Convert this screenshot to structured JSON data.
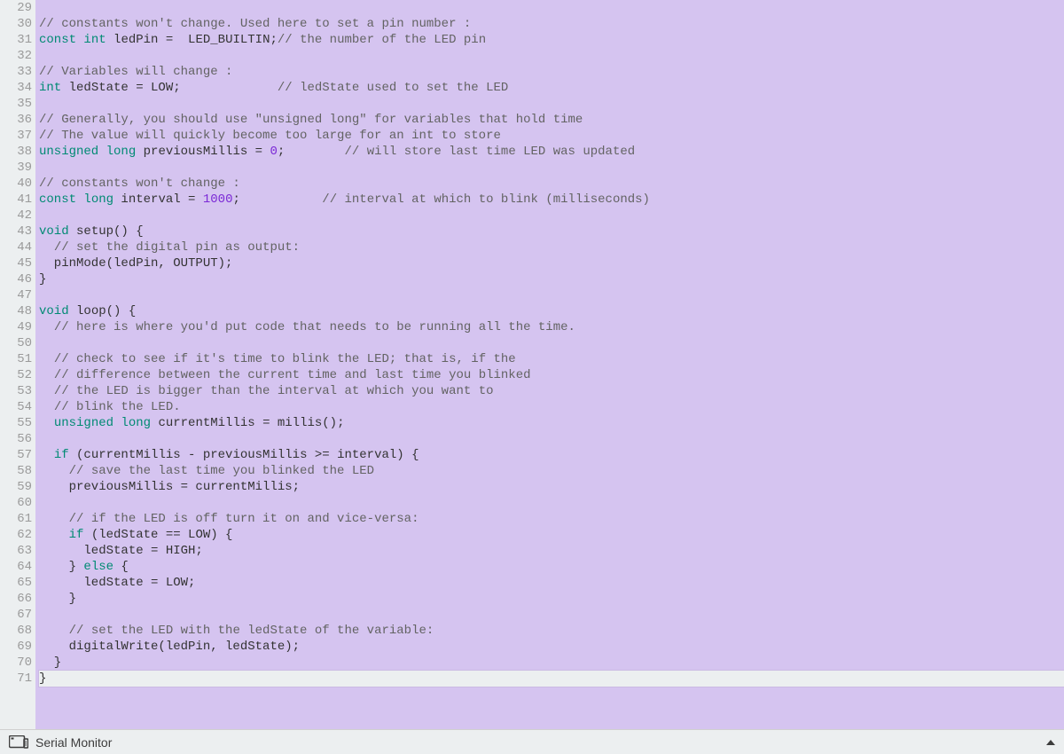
{
  "editor": {
    "first_line_number": 29,
    "cursor_line": 71,
    "lines": [
      [],
      [
        [
          "// constants won't change. Used here to set a pin number :",
          "cmt"
        ]
      ],
      [
        [
          "const",
          "kw"
        ],
        [
          " ",
          "p"
        ],
        [
          "int",
          "kw"
        ],
        [
          " ledPin =  LED_BUILTIN;",
          "p"
        ],
        [
          "// the number of the LED pin",
          "cmt"
        ]
      ],
      [],
      [
        [
          "// Variables will change :",
          "cmt"
        ]
      ],
      [
        [
          "int",
          "kw"
        ],
        [
          " ledState = LOW;             ",
          "p"
        ],
        [
          "// ledState used to set the LED",
          "cmt"
        ]
      ],
      [],
      [
        [
          "// Generally, you should use \"unsigned long\" for variables that hold time",
          "cmt"
        ]
      ],
      [
        [
          "// The value will quickly become too large for an int to store",
          "cmt"
        ]
      ],
      [
        [
          "unsigned",
          "kw"
        ],
        [
          " ",
          "p"
        ],
        [
          "long",
          "kw"
        ],
        [
          " previousMillis = ",
          "p"
        ],
        [
          "0",
          "num"
        ],
        [
          ";        ",
          "p"
        ],
        [
          "// will store last time LED was updated",
          "cmt"
        ]
      ],
      [],
      [
        [
          "// constants won't change :",
          "cmt"
        ]
      ],
      [
        [
          "const",
          "kw"
        ],
        [
          " ",
          "p"
        ],
        [
          "long",
          "kw"
        ],
        [
          " interval = ",
          "p"
        ],
        [
          "1000",
          "num"
        ],
        [
          ";           ",
          "p"
        ],
        [
          "// interval at which to blink (milliseconds)",
          "cmt"
        ]
      ],
      [],
      [
        [
          "void",
          "kw"
        ],
        [
          " setup() {",
          "p"
        ]
      ],
      [
        [
          "  ",
          "p"
        ],
        [
          "// set the digital pin as output:",
          "cmt"
        ]
      ],
      [
        [
          "  pinMode(ledPin, OUTPUT);",
          "p"
        ]
      ],
      [
        [
          "}",
          "p"
        ]
      ],
      [],
      [
        [
          "void",
          "kw"
        ],
        [
          " loop() {",
          "p"
        ]
      ],
      [
        [
          "  ",
          "p"
        ],
        [
          "// here is where you'd put code that needs to be running all the time.",
          "cmt"
        ]
      ],
      [],
      [
        [
          "  ",
          "p"
        ],
        [
          "// check to see if it's time to blink the LED; that is, if the",
          "cmt"
        ]
      ],
      [
        [
          "  ",
          "p"
        ],
        [
          "// difference between the current time and last time you blinked",
          "cmt"
        ]
      ],
      [
        [
          "  ",
          "p"
        ],
        [
          "// the LED is bigger than the interval at which you want to",
          "cmt"
        ]
      ],
      [
        [
          "  ",
          "p"
        ],
        [
          "// blink the LED.",
          "cmt"
        ]
      ],
      [
        [
          "  ",
          "p"
        ],
        [
          "unsigned",
          "kw"
        ],
        [
          " ",
          "p"
        ],
        [
          "long",
          "kw"
        ],
        [
          " currentMillis = millis();",
          "p"
        ]
      ],
      [],
      [
        [
          "  ",
          "p"
        ],
        [
          "if",
          "kw"
        ],
        [
          " (currentMillis - previousMillis >= interval) {",
          "p"
        ]
      ],
      [
        [
          "    ",
          "p"
        ],
        [
          "// save the last time you blinked the LED",
          "cmt"
        ]
      ],
      [
        [
          "    previousMillis = currentMillis;",
          "p"
        ]
      ],
      [],
      [
        [
          "    ",
          "p"
        ],
        [
          "// if the LED is off turn it on and vice-versa:",
          "cmt"
        ]
      ],
      [
        [
          "    ",
          "p"
        ],
        [
          "if",
          "kw"
        ],
        [
          " (ledState == LOW) {",
          "p"
        ]
      ],
      [
        [
          "      ledState = HIGH;",
          "p"
        ]
      ],
      [
        [
          "    } ",
          "p"
        ],
        [
          "else",
          "kw"
        ],
        [
          " {",
          "p"
        ]
      ],
      [
        [
          "      ledState = LOW;",
          "p"
        ]
      ],
      [
        [
          "    }",
          "p"
        ]
      ],
      [],
      [
        [
          "    ",
          "p"
        ],
        [
          "// set the LED with the ledState of the variable:",
          "cmt"
        ]
      ],
      [
        [
          "    digitalWrite(ledPin, ledState);",
          "p"
        ]
      ],
      [
        [
          "  }",
          "p"
        ]
      ],
      [
        [
          "}",
          "p"
        ]
      ]
    ]
  },
  "footer": {
    "label": "Serial Monitor"
  }
}
